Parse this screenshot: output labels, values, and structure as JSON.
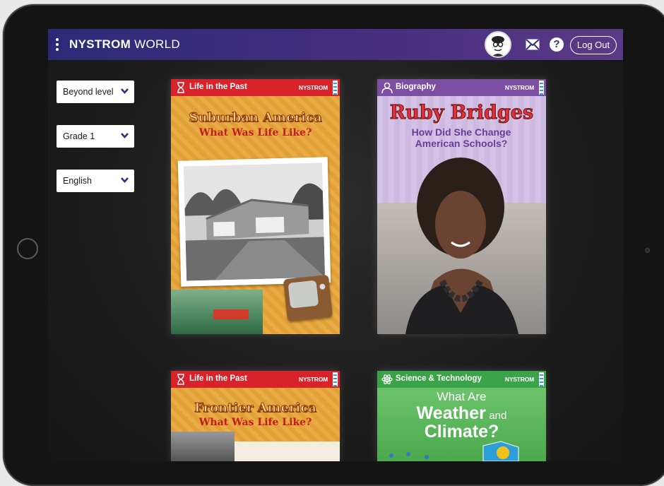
{
  "app": {
    "brand_bold": "NYSTROM",
    "brand_light": "WORLD",
    "logout_label": "Log Out",
    "help_glyph": "?"
  },
  "filters": [
    {
      "value": "Beyond level"
    },
    {
      "value": "Grade 1"
    },
    {
      "value": "English"
    }
  ],
  "books": [
    {
      "category": "Life in the Past",
      "publisher": "NYSTROM",
      "title": "Suburban America",
      "subtitle": "What Was Life Like?",
      "header_color": "#d8232a"
    },
    {
      "category": "Biography",
      "publisher": "NYSTROM",
      "title": "Ruby Bridges",
      "subtitle": "How Did She Change American Schools?",
      "header_color": "#7c4fa3"
    },
    {
      "category": "Life in the Past",
      "publisher": "NYSTROM",
      "title": "Frontier America",
      "subtitle": "What Was Life Like?",
      "header_color": "#d8232a"
    },
    {
      "category": "Science & Technology",
      "publisher": "NYSTROM",
      "title_line1": "What Are",
      "title_line2a": "Weather",
      "title_line2b": "and",
      "title_line3": "Climate?",
      "header_color": "#3aa34a"
    }
  ],
  "icons": [
    "menu-dots-icon",
    "avatar-icon",
    "mail-icon",
    "help-icon",
    "chevron-down-icon",
    "hourglass-icon",
    "person-icon",
    "atom-icon"
  ],
  "colors": {
    "topbar_start": "#2c2a78",
    "topbar_end": "#5a3a86"
  }
}
